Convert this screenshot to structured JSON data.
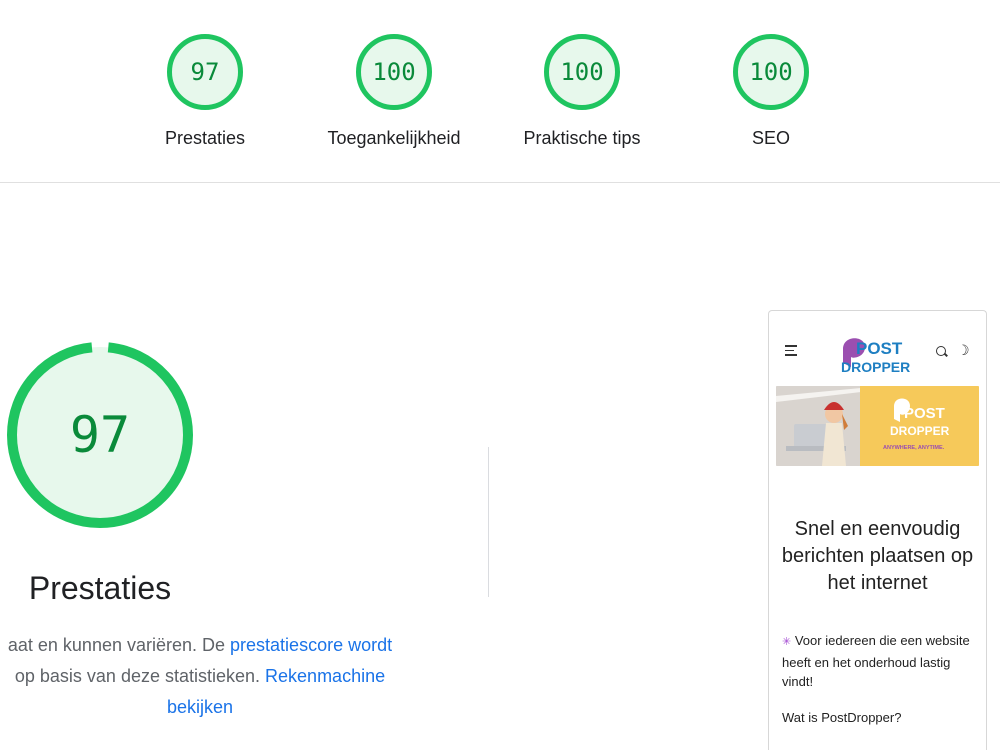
{
  "summary_scores": [
    {
      "value": "97",
      "label": "Prestaties",
      "color": "#1fc560"
    },
    {
      "value": "100",
      "label": "Toegankelijkheid",
      "color": "#1fc560"
    },
    {
      "value": "100",
      "label": "Praktische tips",
      "color": "#1fc560"
    },
    {
      "value": "100",
      "label": "SEO",
      "color": "#1fc560"
    }
  ],
  "category": {
    "score": "97",
    "score_fraction": 0.97,
    "title": "Prestaties",
    "desc_text_1": "aat en kunnen variëren. De ",
    "desc_link_1": "prestatiescore wordt",
    "desc_text_2": "op basis van deze statistieken. ",
    "desc_link_2": "Rekenmachine",
    "desc_link_3": "bekijken"
  },
  "preview": {
    "logo_text_1": "POST",
    "logo_text_2": "DROPPER",
    "banner_logo_1": "POST",
    "banner_logo_2": "DROPPER",
    "banner_tagline": "ANYWHERE, ANYTIME.",
    "headline": "Snel en eenvoudig berichten plaatsen op het internet",
    "intro_spark": "✳",
    "intro": "Voor iedereen die een website heeft en het onderhoud lastig vindt!",
    "question": "Wat is PostDropper?",
    "icons": [
      "menu-icon",
      "search-icon",
      "theme-toggle-icon"
    ]
  },
  "colors": {
    "pass_green": "#1fc560",
    "pass_bg": "#e7f8ec",
    "link_blue": "#1a73e8",
    "logo_purple": "#9b4fb0",
    "logo_blue": "#1e7fc2",
    "banner_yellow": "#f6c95a"
  }
}
